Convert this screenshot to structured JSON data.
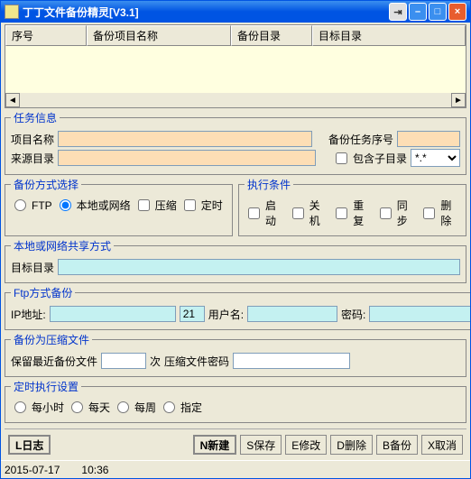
{
  "window": {
    "title": "丁丁文件备份精灵[V3.1]"
  },
  "list": {
    "cols": {
      "seq": "序号",
      "name": "备份项目名称",
      "src": "备份目录",
      "dst": "目标目录"
    },
    "widths": {
      "seq": 90,
      "name": 160,
      "src": 90,
      "dst": 150
    }
  },
  "task": {
    "legend": "任务信息",
    "project_name_lbl": "项目名称",
    "project_name": "",
    "seq_lbl": "备份任务序号",
    "seq": "",
    "src_lbl": "来源目录",
    "src": "",
    "include_sub_lbl": "包含子目录",
    "include_sub": false,
    "filter": "*.*"
  },
  "method": {
    "legend": "备份方式选择",
    "ftp": "FTP",
    "local": "本地或网络",
    "compress": "压缩",
    "timing": "定时",
    "selected": "local"
  },
  "cond": {
    "legend": "执行条件",
    "startup": "启动",
    "shutdown": "关机",
    "repeat": "重复",
    "sync": "同步",
    "delete": "删除"
  },
  "share": {
    "legend": "本地或网络共享方式",
    "target_lbl": "目标目录",
    "target": ""
  },
  "ftp": {
    "legend": "Ftp方式备份",
    "ip_lbl": "IP地址:",
    "ip": "",
    "port": "21",
    "user_lbl": "用户名:",
    "user": "",
    "pass_lbl": "密码:",
    "pass": ""
  },
  "zip": {
    "legend": "备份为压缩文件",
    "keep_lbl": "保留最近备份文件",
    "keep": "",
    "times": "次",
    "zippass_lbl": "压缩文件密码",
    "zippass": ""
  },
  "timing": {
    "legend": "定时执行设置",
    "hourly": "每小时",
    "daily": "每天",
    "weekly": "每周",
    "specify": "指定"
  },
  "buttons": {
    "log": "L日志",
    "new": "N新建",
    "save": "S保存",
    "edit": "E修改",
    "del": "D删除",
    "backup": "B备份",
    "cancel": "X取消"
  },
  "status": {
    "date": "2015-07-17",
    "time": "10:36"
  }
}
